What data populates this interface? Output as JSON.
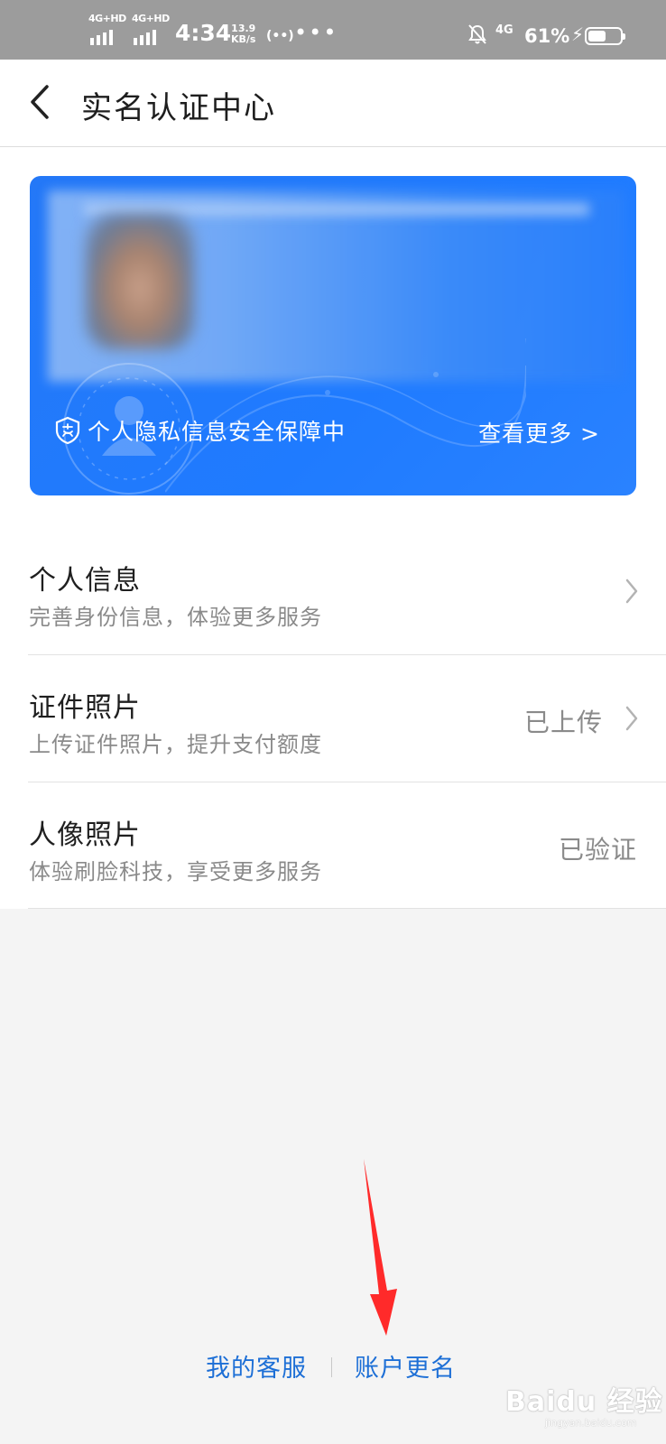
{
  "status_bar": {
    "network_1": "4G+HD",
    "network_2": "4G+HD",
    "time": "4:34",
    "speed_value": "13.9",
    "speed_unit": "KB/s",
    "hotspot": "(••)",
    "more": "•••",
    "network_right": "4G",
    "battery_percent": "61%",
    "battery_level": 0.61
  },
  "header": {
    "title": "实名认证中心"
  },
  "card": {
    "privacy_text": "个人隐私信息安全保障中",
    "more_label": "查看更多 >"
  },
  "list": {
    "items": [
      {
        "title": "个人信息",
        "subtitle": "完善身份信息，体验更多服务",
        "value": ""
      },
      {
        "title": "证件照片",
        "subtitle": "上传证件照片，提升支付额度",
        "value": "已上传"
      },
      {
        "title": "人像照片",
        "subtitle": "体验刷脸科技，享受更多服务",
        "value": "已验证"
      }
    ]
  },
  "footer": {
    "customer_service": "我的客服",
    "rename_account": "账户更名"
  },
  "watermark": {
    "text": "Baidu 经验",
    "url": "jingyan.baidu.com"
  },
  "colors": {
    "accent": "#1f7bff",
    "link": "#1d6fd6",
    "annotation_arrow": "#ff2a2a"
  }
}
